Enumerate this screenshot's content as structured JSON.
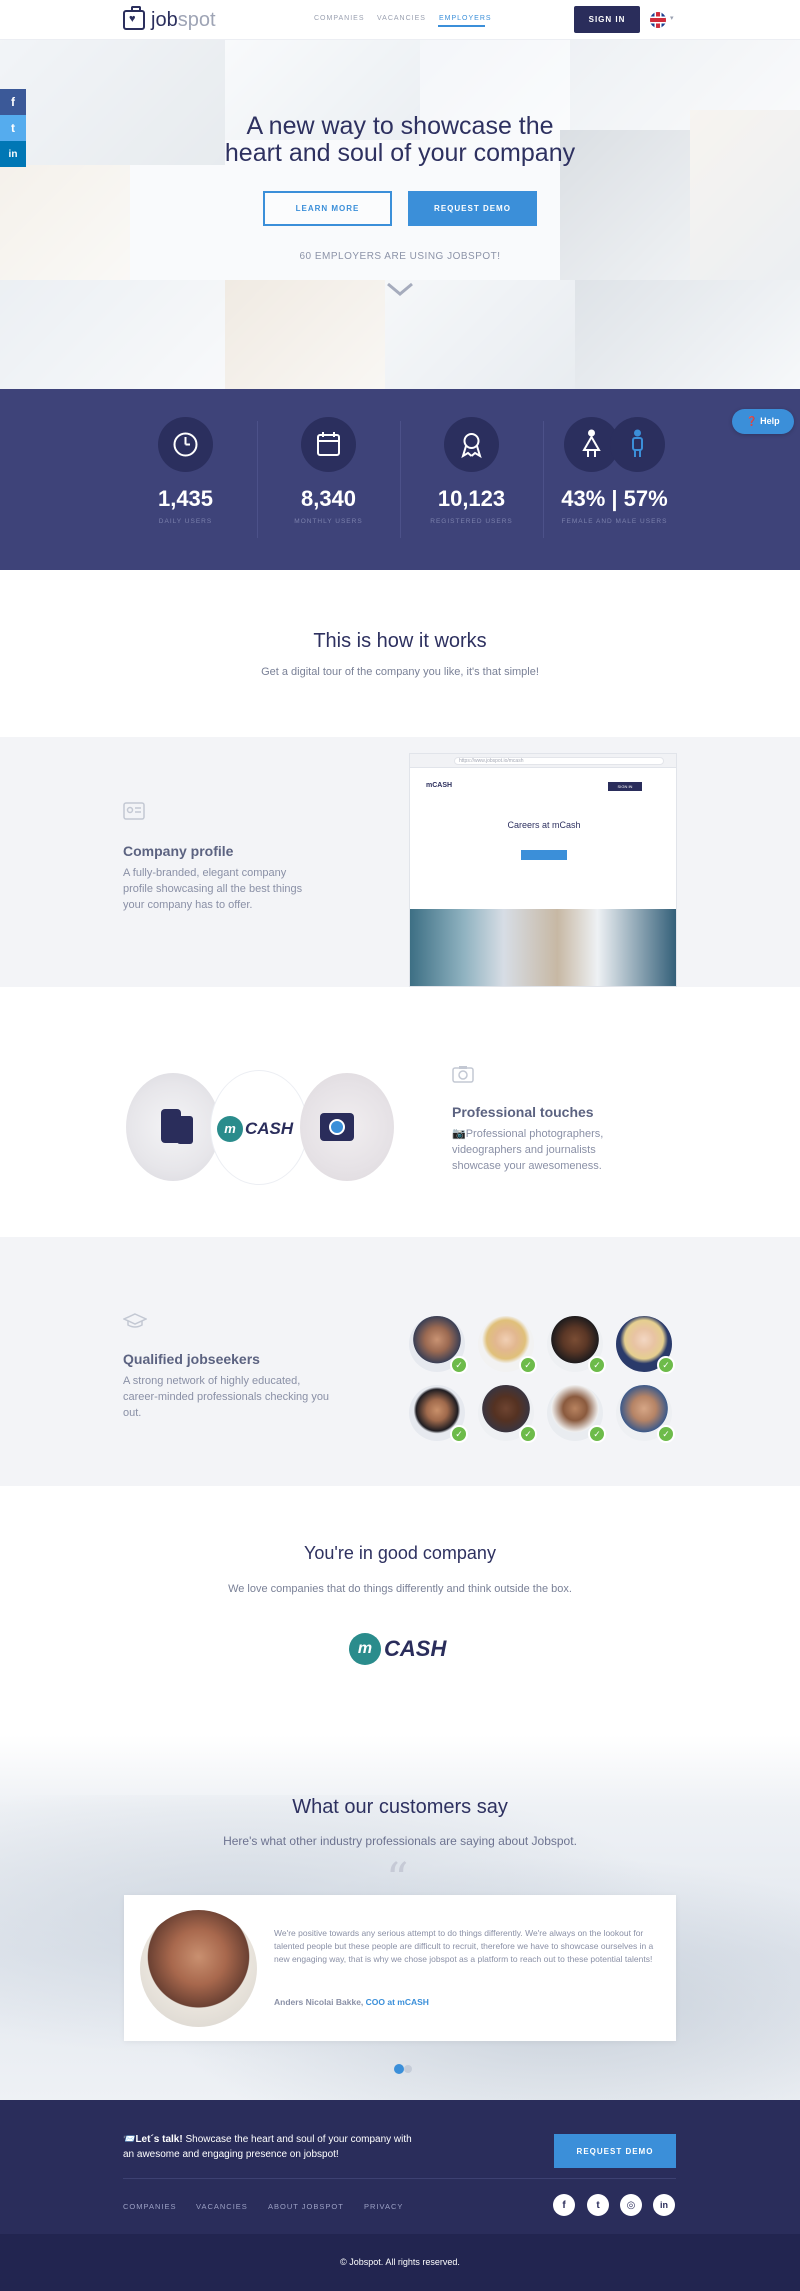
{
  "header": {
    "logo_text_a": "job",
    "logo_text_b": "spot",
    "nav": [
      {
        "label": "COMPANIES"
      },
      {
        "label": "VACANCIES"
      },
      {
        "label": "EMPLOYERS",
        "active": true
      }
    ],
    "signin_label": "SIGN IN",
    "language_icon": "uk-flag-icon"
  },
  "social_sidebar": [
    {
      "label": "f",
      "icon": "facebook-icon",
      "color": "#3b5998"
    },
    {
      "label": "t",
      "icon": "twitter-icon",
      "color": "#55acee"
    },
    {
      "label": "in",
      "icon": "linkedin-icon",
      "color": "#0077b5"
    }
  ],
  "hero": {
    "title_line1": "A new way to showcase the",
    "title_line2": "heart and soul of your company",
    "learn_more": "LEARN MORE",
    "request_demo": "REQUEST DEMO",
    "employers_count": "60 EMPLOYERS ARE USING JOBSPOT!",
    "scroll_icon": "chevron-down-icon"
  },
  "stats": [
    {
      "value": "1,435",
      "label": "DAILY USERS",
      "icon": "clock-icon"
    },
    {
      "value": "8,340",
      "label": "MONTHLY USERS",
      "icon": "calendar-icon"
    },
    {
      "value": "10,123",
      "label": "REGISTERED USERS",
      "icon": "award-icon"
    },
    {
      "value": "43% | 57%",
      "label": "FEMALE AND MALE USERS",
      "icon": "gender-icon"
    }
  ],
  "help_label": "❓ Help",
  "how": {
    "title": "This is how it works",
    "subtitle": "Get a digital tour of the company you like, it's that simple!"
  },
  "features": {
    "profile": {
      "title": "Company profile",
      "text": "A fully-branded, elegant company profile showcasing all the best things your company has to offer.",
      "icon": "profile-card-icon",
      "mock": {
        "url": "https://www.jobspot.io/mcash",
        "logo": "mCASH",
        "signin": "SIGN IN",
        "title": "Careers at mCash"
      }
    },
    "touches": {
      "title": "Professional touches",
      "text": "📷Professional photographers, videographers and journalists showcase your awesomeness.",
      "icon": "camera-icon",
      "logo": "CASH"
    },
    "jobseekers": {
      "title": "Qualified jobseekers",
      "text": "A strong network of highly educated, career-minded professionals checking you out.",
      "icon": "graduation-cap-icon",
      "check": "✓"
    }
  },
  "good_company": {
    "title": "You're in good company",
    "subtitle": "We love companies that do things differently and think outside the box.",
    "logo_text": "CASH"
  },
  "testimonials": {
    "title": "What our customers say",
    "subtitle": "Here's what other industry professionals are saying about Jobspot.",
    "quote_mark": "“",
    "quote": "We're positive towards any serious attempt to do things differently. We're always on the lookout for talented people but these people are difficult to recruit, therefore we have to showcase ourselves in a new engaging way, that is why we chose jobspot as a platform to reach out to these potential talents!",
    "author_name": "Anders Nicolai Bakke, ",
    "author_role": "COO at mCASH"
  },
  "footer": {
    "cta_bold": "📨Let´s talk!",
    "cta_text": " Showcase the heart and soul of your company with an awesome and engaging presence on jobspot!",
    "cta_button": "REQUEST DEMO",
    "links": [
      {
        "label": "COMPANIES"
      },
      {
        "label": "VACANCIES"
      },
      {
        "label": "ABOUT JOBSPOT"
      },
      {
        "label": "PRIVACY"
      }
    ],
    "social": [
      {
        "label": "f",
        "icon": "facebook-icon"
      },
      {
        "label": "t",
        "icon": "twitter-icon"
      },
      {
        "label": "◎",
        "icon": "instagram-icon"
      },
      {
        "label": "in",
        "icon": "linkedin-icon"
      }
    ],
    "copyright": "© Jobspot. All rights reserved."
  },
  "colors": {
    "brand_navy": "#2a2d5b",
    "accent_blue": "#3b8fd9",
    "stats_bg": "#3e4379",
    "check_green": "#6dbb4a"
  }
}
